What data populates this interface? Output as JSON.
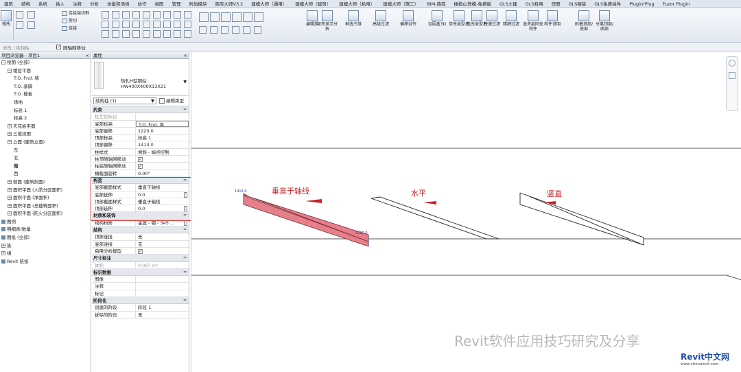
{
  "ribbon_tabs": [
    "建筑",
    "结构",
    "系统",
    "插入",
    "注释",
    "分析",
    "体量和场地",
    "协作",
    "视图",
    "管理",
    "附加模块",
    "族库大师V3.2",
    "建模大师（通用）",
    "建模大师（建筑）",
    "建模大师（机电）",
    "建模大师（施工）",
    "BIM-族库",
    "橄榄山快模-免费版",
    "GLS土建",
    "GLS机电",
    "快图",
    "GLS精装",
    "GLS免费插件",
    "Plugin!Plug",
    "Fuzor Plugin"
  ],
  "ribbon": {
    "modify_label": "修改",
    "join_label": "连接端切割",
    "cut_label": "剪切",
    "connect_label": "连接",
    "large_buttons": [
      "编辑族",
      "常亮显示分析",
      "框选三维",
      "高级过滤",
      "偏移对齐",
      "包围盒3D",
      "单改类型名",
      "批改类型名",
      "快速过滤",
      "精细过滤",
      "选多层同处构件",
      "构件说明",
      "附着顶部/底部",
      "分离顶部/底部"
    ]
  },
  "options_bar": {
    "left_label": "修改 | 结构柱",
    "checkbox_label": "随轴网移动",
    "checkbox_checked": true
  },
  "project_browser": {
    "title": "项目浏览器 - 项目1",
    "close": "×",
    "items": [
      {
        "label": "视图 (全部)",
        "level": 0,
        "toggle": "⊟"
      },
      {
        "label": "楼层平面",
        "level": 1,
        "toggle": "⊟"
      },
      {
        "label": "T.O. Fnd. 墙",
        "level": 2,
        "toggle": ""
      },
      {
        "label": "T.O. 基脚",
        "level": 2,
        "toggle": ""
      },
      {
        "label": "T.O. 楼板",
        "level": 2,
        "toggle": ""
      },
      {
        "label": "场地",
        "level": 2,
        "toggle": ""
      },
      {
        "label": "标高 1",
        "level": 2,
        "toggle": ""
      },
      {
        "label": "标高 2",
        "level": 2,
        "toggle": ""
      },
      {
        "label": "天花板平面",
        "level": 1,
        "toggle": "⊞"
      },
      {
        "label": "三维视图",
        "level": 1,
        "toggle": "⊞"
      },
      {
        "label": "立面 (建筑立面)",
        "level": 1,
        "toggle": "⊟"
      },
      {
        "label": "东",
        "level": 2,
        "toggle": ""
      },
      {
        "label": "北",
        "level": 2,
        "toggle": ""
      },
      {
        "label": "南",
        "level": 2,
        "toggle": "",
        "bold": true
      },
      {
        "label": "西",
        "level": 2,
        "toggle": ""
      },
      {
        "label": "剖面 (建筑剖面)",
        "level": 1,
        "toggle": "⊞"
      },
      {
        "label": "面积平面 (人防分区面积)",
        "level": 1,
        "toggle": "⊞"
      },
      {
        "label": "面积平面 (净面积)",
        "level": 1,
        "toggle": "⊞"
      },
      {
        "label": "面积平面 (总建筑面积)",
        "level": 1,
        "toggle": "⊞"
      },
      {
        "label": "面积平面 (防火分区面积)",
        "level": 1,
        "toggle": "⊞"
      },
      {
        "label": "图例",
        "level": 0,
        "toggle": ""
      },
      {
        "label": "明细表/数量",
        "level": 0,
        "toggle": ""
      },
      {
        "label": "图纸 (全部)",
        "level": 0,
        "toggle": ""
      },
      {
        "label": "族",
        "level": 0,
        "toggle": "⊞"
      },
      {
        "label": "组",
        "level": 0,
        "toggle": "⊞"
      },
      {
        "label": "Revit 链接",
        "level": 0,
        "toggle": ""
      }
    ]
  },
  "properties": {
    "title": "属性",
    "close": "×",
    "type_name_1": "热轧H型钢柱",
    "type_name_2": "HW400X400X13X21",
    "filter_value": "结构柱 (1)",
    "edit_type": "编辑类型",
    "groups": [
      {
        "title": "约束",
        "rows": [
          {
            "k": "柱定位标记",
            "v": "",
            "dim": true
          },
          {
            "k": "底部标高",
            "v": "T.O. Fnd. 墙",
            "box": true
          },
          {
            "k": "底部偏移",
            "v": "1220.0"
          },
          {
            "k": "顶部标高",
            "v": "标高 1"
          },
          {
            "k": "顶部偏移",
            "v": "1413.0"
          },
          {
            "k": "柱样式",
            "v": "倾斜 - 端点控制"
          },
          {
            "k": "柱顶随轴网移动",
            "v": "",
            "check": true
          },
          {
            "k": "柱底随轴网移动",
            "v": "",
            "check": true
          },
          {
            "k": "横截面旋转",
            "v": "0.00°"
          }
        ]
      },
      {
        "title": "构造",
        "rows": [
          {
            "k": "底部截面样式",
            "v": "垂直于轴线"
          },
          {
            "k": "底部延伸",
            "v": "0.0",
            "spin": true
          },
          {
            "k": "顶部截面样式",
            "v": "垂直于轴线"
          },
          {
            "k": "顶部延伸",
            "v": "0.0",
            "spin": true
          }
        ]
      },
      {
        "title": "材质和装饰",
        "rows": [
          {
            "k": "结构材质",
            "v": "金属 - 钢 - 345 ...",
            "spin": true
          }
        ]
      },
      {
        "title": "结构",
        "rows": [
          {
            "k": "顶部连接",
            "v": "无"
          },
          {
            "k": "底部连接",
            "v": "无"
          },
          {
            "k": "启用分析模型",
            "v": "",
            "check": true
          }
        ]
      },
      {
        "title": "尺寸标注",
        "rows": [
          {
            "k": "体积",
            "v": "0.097 m³",
            "dim": true
          }
        ]
      },
      {
        "title": "标识数据",
        "rows": [
          {
            "k": "图像",
            "v": ""
          },
          {
            "k": "注释",
            "v": ""
          },
          {
            "k": "标记",
            "v": ""
          }
        ]
      },
      {
        "title": "阶段化",
        "rows": [
          {
            "k": "创建的阶段",
            "v": "阶段 1"
          },
          {
            "k": "拆除的阶段",
            "v": "无"
          }
        ]
      }
    ]
  },
  "canvas": {
    "label_perpendicular": "垂直于轴线",
    "label_horizontal": "水平",
    "label_vertical": "竖直",
    "dim_left": "1413.0",
    "dim_right": "1220.0",
    "watermark": "Revit软件应用技巧研究及分享",
    "logo_text": "Revit中文网",
    "logo_url": "www.chinarevit.com",
    "accent": "#c8222a",
    "highlight_fill": "#e57f8a"
  }
}
